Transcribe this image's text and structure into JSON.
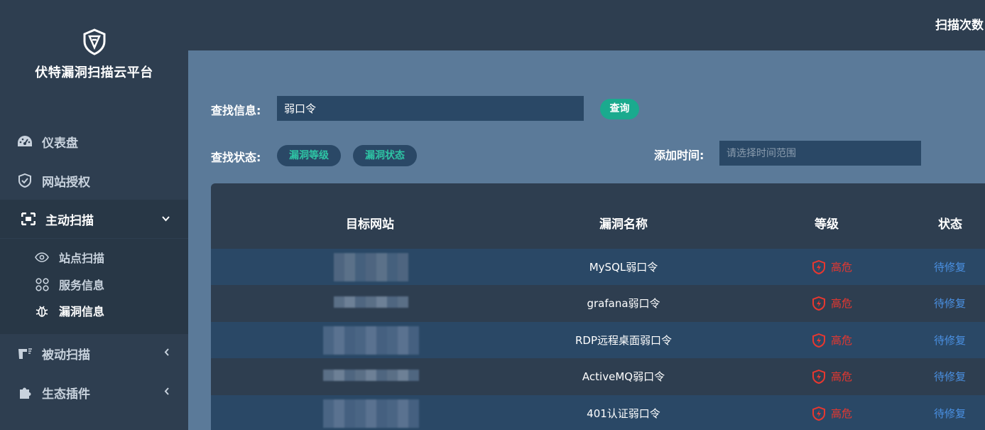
{
  "app": {
    "title": "伏特漏洞扫描云平台"
  },
  "sidebar": {
    "items": [
      {
        "label": "仪表盘",
        "icon": "dashboard-icon"
      },
      {
        "label": "网站授权",
        "icon": "shield-check-icon"
      },
      {
        "label": "主动扫描",
        "icon": "scan-frame-icon",
        "expanded": true,
        "children": [
          {
            "label": "站点扫描",
            "icon": "eye-icon"
          },
          {
            "label": "服务信息",
            "icon": "apps-grid-icon"
          },
          {
            "label": "漏洞信息",
            "icon": "bug-icon",
            "current": true
          }
        ]
      },
      {
        "label": "被动扫描",
        "icon": "passive-scan-icon"
      },
      {
        "label": "生态插件",
        "icon": "puzzle-icon"
      }
    ]
  },
  "header": {
    "scan_count_label": "扫描次数"
  },
  "search": {
    "info_label": "查找信息:",
    "info_value": "弱口令",
    "query_button": "查询",
    "status_label": "查找状态:",
    "filter_level": "漏洞等级",
    "filter_status": "漏洞状态",
    "time_label": "添加时间:",
    "time_placeholder": "请选择时间范围"
  },
  "table": {
    "columns": [
      "目标网站",
      "漏洞名称",
      "等级",
      "状态"
    ],
    "rows": [
      {
        "target": "",
        "name": "MySQL弱口令",
        "level": "高危",
        "status": "待修复"
      },
      {
        "target": "",
        "name": "grafana弱口令",
        "level": "高危",
        "status": "待修复"
      },
      {
        "target": "",
        "name": "RDP远程桌面弱口令",
        "level": "高危",
        "status": "待修复"
      },
      {
        "target": "",
        "name": "ActiveMQ弱口令",
        "level": "高危",
        "status": "待修复"
      },
      {
        "target": "",
        "name": "401认证弱口令",
        "level": "高危",
        "status": "待修复"
      }
    ]
  },
  "colors": {
    "sidebar_bg": "#2e3e50",
    "content_bg": "#5b7a99",
    "accent_green": "#1aaa8e",
    "danger_red": "#e8372f",
    "link_blue": "#4a90e2"
  }
}
